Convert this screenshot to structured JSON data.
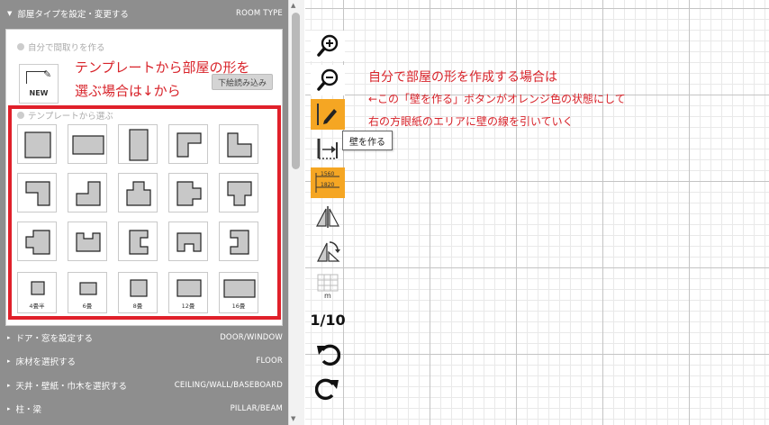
{
  "left_panel": {
    "room_header": {
      "label_jp": "部屋タイプを設定・変更する",
      "label_en": "ROOM TYPE"
    },
    "custom_option_label": "自分で間取りを作る",
    "new_label": "NEW",
    "underlay_button": "下絵読み込み",
    "template_option_label": "テンプレートから選ぶ",
    "note_template_line1": "テンプレートから部屋の形を",
    "note_template_line2": "選ぶ場合は↓から",
    "size_labels": [
      "4畳半",
      "6畳",
      "8畳",
      "12畳",
      "16畳"
    ],
    "sections": [
      {
        "jp": "ドア・窓を設定する",
        "en": "DOOR/WINDOW"
      },
      {
        "jp": "床材を選択する",
        "en": "FLOOR"
      },
      {
        "jp": "天井・壁紙・巾木を選択する",
        "en": "CEILING/WALL/BASEBOARD"
      },
      {
        "jp": "柱・梁",
        "en": "PILLAR/BEAM"
      }
    ]
  },
  "toolbar": {
    "tooltip": "壁を作る",
    "dimension_top": "1560",
    "dimension_bottom": "1820",
    "meter_label": "m",
    "scale_label": "1/10"
  },
  "canvas_note": {
    "line1": "自分で部屋の形を作成する場合は",
    "line2": "←この「壁を作る」ボタンがオレンジ色の状態にして",
    "line3": "右の方眼紙のエリアに壁の線を引いていく"
  },
  "colors": {
    "accent_orange": "#f5a623",
    "note_red": "#d8232a",
    "panel_gray": "#8e8e8e"
  }
}
